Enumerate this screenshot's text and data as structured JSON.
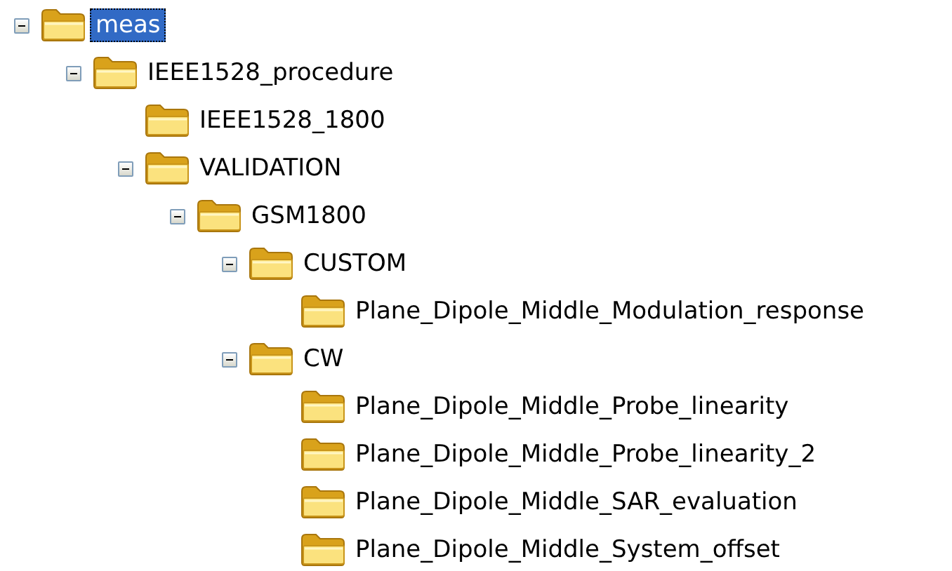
{
  "tree": [
    {
      "label": "meas",
      "selected": true,
      "expanded": true,
      "children": [
        {
          "label": "IEEE1528_procedure",
          "selected": false,
          "expanded": true,
          "children": [
            {
              "label": "IEEE1528_1800",
              "selected": false
            },
            {
              "label": "VALIDATION",
              "selected": false,
              "expanded": true,
              "children": [
                {
                  "label": "GSM1800",
                  "selected": false,
                  "expanded": true,
                  "children": [
                    {
                      "label": "CUSTOM",
                      "selected": false,
                      "expanded": true,
                      "children": [
                        {
                          "label": "Plane_Dipole_Middle_Modulation_response",
                          "selected": false
                        }
                      ]
                    },
                    {
                      "label": "CW",
                      "selected": false,
                      "expanded": true,
                      "children": [
                        {
                          "label": "Plane_Dipole_Middle_Probe_linearity",
                          "selected": false
                        },
                        {
                          "label": "Plane_Dipole_Middle_Probe_linearity_2",
                          "selected": false
                        },
                        {
                          "label": "Plane_Dipole_Middle_SAR_evaluation",
                          "selected": false
                        },
                        {
                          "label": "Plane_Dipole_Middle_System_offset",
                          "selected": false
                        }
                      ]
                    }
                  ]
                }
              ]
            }
          ]
        }
      ]
    }
  ]
}
